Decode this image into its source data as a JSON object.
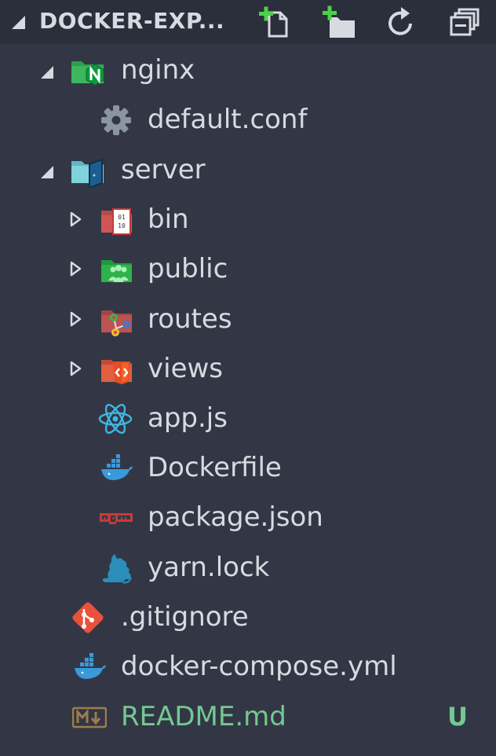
{
  "explorer": {
    "title": "DOCKER-EXP...",
    "actions": [
      {
        "name": "new-file-icon"
      },
      {
        "name": "new-folder-icon"
      },
      {
        "name": "refresh-icon"
      },
      {
        "name": "collapse-all-icon"
      }
    ]
  },
  "tree": [
    {
      "label": "nginx",
      "kind": "folder",
      "expanded": true,
      "icon": "nginx-folder-icon"
    },
    {
      "label": "default.conf",
      "kind": "file",
      "icon": "gear-icon"
    },
    {
      "label": "server",
      "kind": "folder",
      "expanded": true,
      "icon": "server-folder-icon"
    },
    {
      "label": "bin",
      "kind": "folder",
      "expanded": false,
      "icon": "bin-folder-icon"
    },
    {
      "label": "public",
      "kind": "folder",
      "expanded": false,
      "icon": "public-folder-icon"
    },
    {
      "label": "routes",
      "kind": "folder",
      "expanded": false,
      "icon": "routes-folder-icon"
    },
    {
      "label": "views",
      "kind": "folder",
      "expanded": false,
      "icon": "views-folder-icon"
    },
    {
      "label": "app.js",
      "kind": "file",
      "icon": "react-icon"
    },
    {
      "label": "Dockerfile",
      "kind": "file",
      "icon": "docker-icon"
    },
    {
      "label": "package.json",
      "kind": "file",
      "icon": "npm-icon"
    },
    {
      "label": "yarn.lock",
      "kind": "file",
      "icon": "yarn-icon"
    },
    {
      "label": ".gitignore",
      "kind": "file",
      "icon": "git-icon"
    },
    {
      "label": "docker-compose.yml",
      "kind": "file",
      "icon": "docker-icon"
    },
    {
      "label": "README.md",
      "kind": "file",
      "icon": "markdown-icon",
      "status": "U"
    }
  ],
  "colors": {
    "background": "#333745",
    "header_background": "#2b2f3b",
    "text": "#d7dae0",
    "untracked": "#73c991"
  }
}
